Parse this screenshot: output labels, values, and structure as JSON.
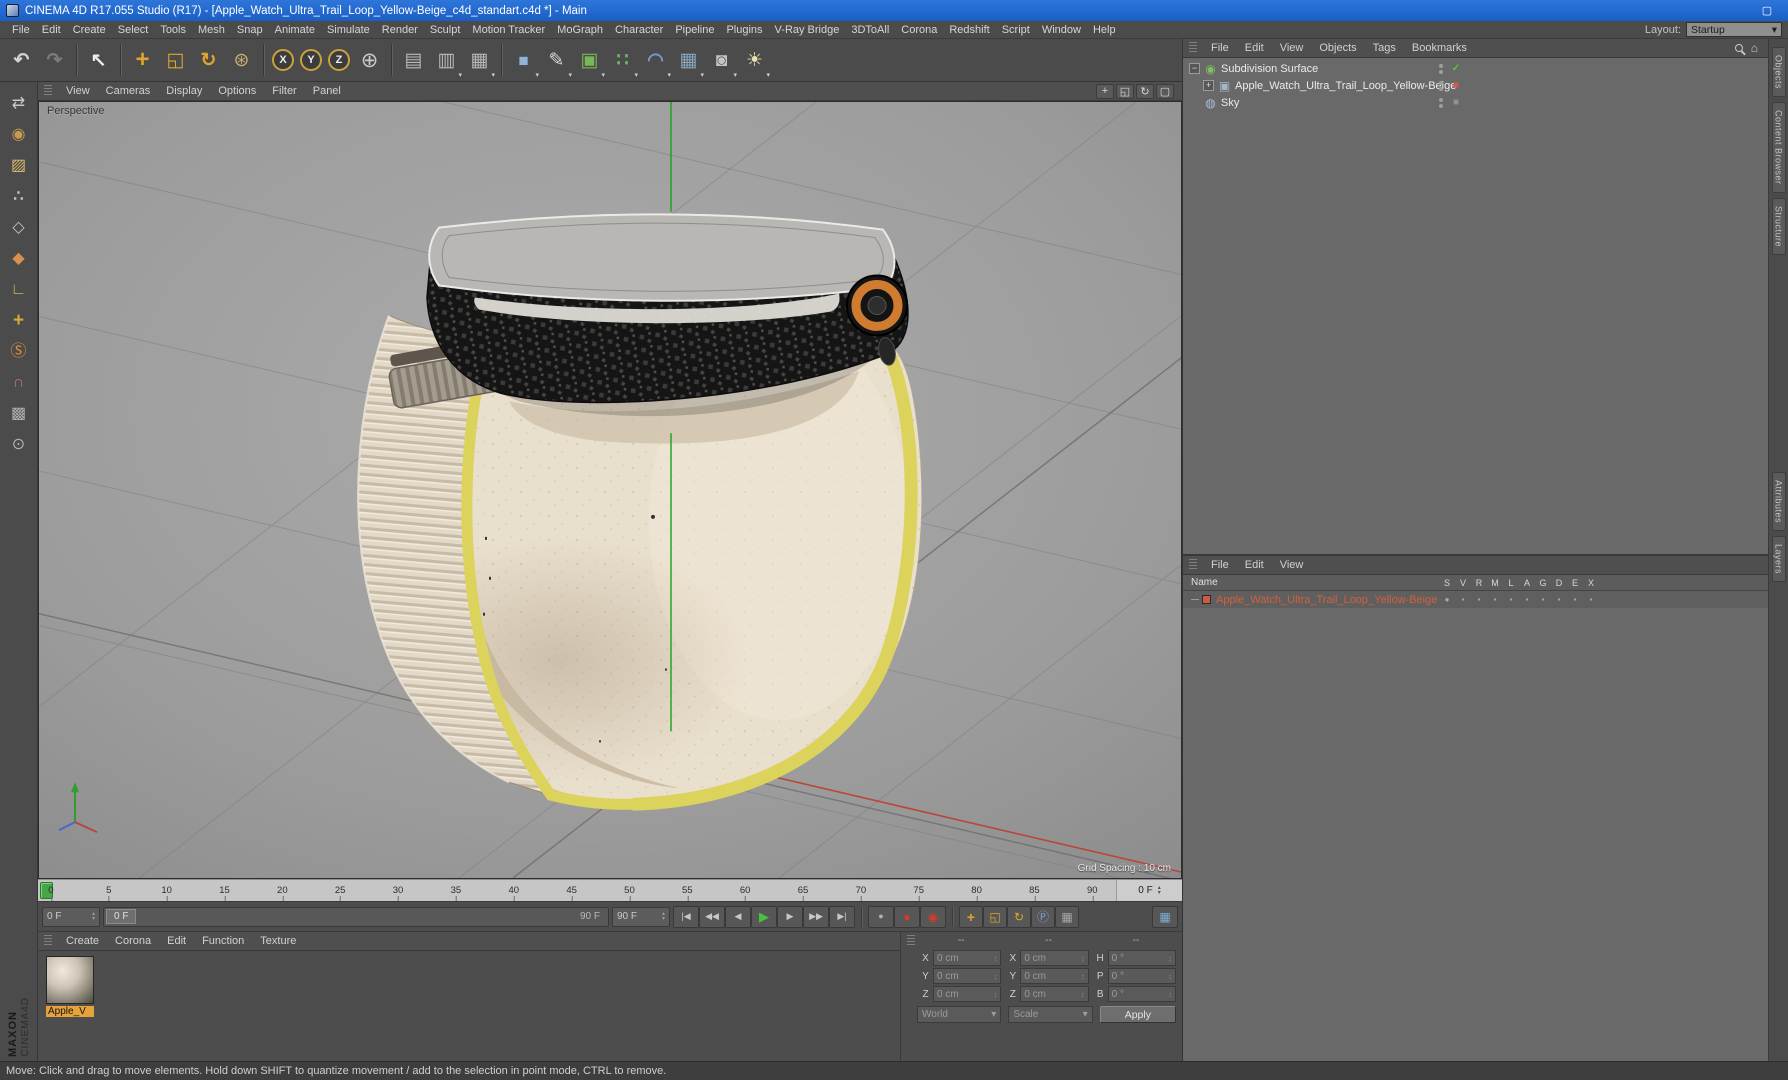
{
  "app": {
    "title": "CINEMA 4D R17.055 Studio (R17) - [Apple_Watch_Ultra_Trail_Loop_Yellow-Beige_c4d_standart.c4d *] - Main",
    "window_buttons": [
      {
        "name": "minimize-button",
        "glyph": "–"
      },
      {
        "name": "maximize-button",
        "glyph": "▢"
      },
      {
        "name": "close-button",
        "glyph": "×"
      }
    ]
  },
  "icons": {
    "chevron_down": "▾",
    "arrow_up": "▴",
    "arrow_down": "▾",
    "home": "⌂"
  },
  "menu_bar": {
    "items": [
      "File",
      "Edit",
      "Create",
      "Select",
      "Tools",
      "Mesh",
      "Snap",
      "Animate",
      "Simulate",
      "Render",
      "Sculpt",
      "Motion Tracker",
      "MoGraph",
      "Character",
      "Pipeline",
      "Plugins",
      "V-Ray Bridge",
      "3DToAll",
      "Corona",
      "Redshift",
      "Script",
      "Window",
      "Help"
    ],
    "layout_label": "Layout:",
    "layout_value": "Startup"
  },
  "toolbar": {
    "history": [
      {
        "name": "undo-icon",
        "glyph": "↶",
        "style": "color:#d2d2d2;font-weight:bold"
      },
      {
        "name": "redo-icon",
        "glyph": "↷",
        "style": "color:#7b7b7b;font-weight:bold"
      }
    ],
    "selection": [
      {
        "name": "live-selection-icon",
        "glyph": "↖",
        "style": "color:#ececec;font-weight:bold"
      }
    ],
    "transform": [
      {
        "name": "move-icon",
        "glyph": "+",
        "style": "color:#dca62e;font-weight:bold;font-size:24px"
      },
      {
        "name": "scale-icon",
        "glyph": "◱",
        "style": "color:#dca62e"
      },
      {
        "name": "rotate-icon",
        "glyph": "↻",
        "style": "color:#dca62e;font-weight:bold"
      },
      {
        "name": "last-tool-icon",
        "glyph": "⊛",
        "style": "color:#c8b070"
      }
    ],
    "axis": [
      {
        "name": "lock-x-axis-button",
        "letter": "X"
      },
      {
        "name": "lock-y-axis-button",
        "letter": "Y"
      },
      {
        "name": "lock-z-axis-button",
        "letter": "Z"
      }
    ],
    "coord_glyph": "⊕",
    "render": [
      {
        "name": "render-view-icon",
        "glyph": "▤",
        "style": "color:#b8b8b8"
      },
      {
        "name": "render-picture-viewer-icon",
        "glyph": "▥",
        "style": "color:#b8b8b8",
        "dd": "▾"
      },
      {
        "name": "render-settings-icon",
        "glyph": "▦",
        "style": "color:#b8b8b8",
        "dd": "▾"
      }
    ],
    "create": [
      {
        "name": "primitive-cube-icon",
        "glyph": "■",
        "style": "color:#8fb4d8;font-size:17px",
        "dd": "▾"
      },
      {
        "name": "spline-pen-icon",
        "glyph": "✎",
        "style": "color:#d8d8d8",
        "dd": "▾"
      },
      {
        "name": "subdivision-generator-icon",
        "glyph": "▣",
        "style": "color:#78b858",
        "dd": "▾"
      },
      {
        "name": "mograph-icon",
        "glyph": "∷",
        "style": "color:#6cb46c;font-weight:bold",
        "dd": "▾"
      },
      {
        "name": "deformer-icon",
        "glyph": "◠",
        "style": "color:#7898d8;font-weight:bold",
        "dd": "▾"
      },
      {
        "name": "environment-icon",
        "glyph": "▦",
        "style": "color:#88a8c0",
        "dd": "▾"
      },
      {
        "name": "camera-icon",
        "glyph": "◙",
        "style": "color:#c4c4c4",
        "dd": "▾"
      },
      {
        "name": "light-icon",
        "glyph": "☀",
        "style": "color:#e8e0b0",
        "dd": "▾"
      }
    ]
  },
  "left_toolbar": {
    "items": [
      {
        "name": "make-editable-icon",
        "glyph": "⇄",
        "style": "color:#c8c8c8"
      },
      {
        "name": "model-mode-icon",
        "glyph": "◉",
        "style": "color:#c89a50"
      },
      {
        "name": "texture-mode-icon",
        "glyph": "▨",
        "style": "color:#d8b868"
      },
      {
        "name": "points-mode-icon",
        "glyph": "∴",
        "style": "color:#c4c4c4;font-weight:bold"
      },
      {
        "name": "edges-mode-icon",
        "glyph": "◇",
        "style": "color:#c4c4c4"
      },
      {
        "name": "polygons-mode-icon",
        "glyph": "◆",
        "style": "color:#d89050"
      },
      {
        "name": "workplane-mode-icon",
        "glyph": "∟",
        "style": "color:#d0b060;font-weight:bold"
      },
      {
        "name": "axis-modification-icon",
        "glyph": "+",
        "style": "color:#d8a838;font-weight:bold;font-size:19px"
      },
      {
        "name": "solo-mode-icon",
        "glyph": "Ⓢ",
        "style": "color:#e09040"
      },
      {
        "name": "snap-icon",
        "glyph": "∩",
        "style": "color:#c87070;font-weight:bold"
      },
      {
        "name": "lock-workplane-icon",
        "glyph": "▩",
        "style": "color:#b0b0b0"
      },
      {
        "name": "workplane-icon",
        "glyph": "⊙",
        "style": "color:#b0b0b0"
      }
    ]
  },
  "viewport": {
    "menus": [
      "View",
      "Cameras",
      "Display",
      "Options",
      "Filter",
      "Panel"
    ],
    "label": "Perspective",
    "grid_spacing": "Grid Spacing : 10 cm",
    "nav_icons": [
      {
        "name": "pan-view-icon",
        "glyph": "+"
      },
      {
        "name": "zoom-view-icon",
        "glyph": "◱"
      },
      {
        "name": "rotate-view-icon",
        "glyph": "↻"
      },
      {
        "name": "toggle-view-icon",
        "glyph": "▢"
      }
    ]
  },
  "object_manager": {
    "menus": [
      "File",
      "Edit",
      "View",
      "Objects",
      "Tags",
      "Bookmarks"
    ],
    "rows": [
      {
        "label": "Subdivision Surface",
        "expander": "−",
        "icon_glyph": "◉",
        "icon_style": "color:#7fbf5f",
        "row_style": "padding-left:6px",
        "status_glyph": "✓",
        "status_style": "color:#58c040;font-weight:bold"
      },
      {
        "label": "Apple_Watch_Ultra_Trail_Loop_Yellow-Beige",
        "expander": "+",
        "icon_glyph": "▣",
        "icon_style": "color:#9fb8cc",
        "row_style": "padding-left:20px",
        "status_glyph": "■",
        "status_style": "color:#cc5f43"
      },
      {
        "label": "Sky",
        "expander": "",
        "exp_style": "visibility:hidden",
        "icon_glyph": "◍",
        "icon_style": "color:#a8c0d8",
        "row_style": "padding-left:6px",
        "status_glyph": "■",
        "status_style": "color:#909090"
      }
    ]
  },
  "layer_manager": {
    "menus": [
      "File",
      "Edit",
      "View"
    ],
    "name_header": "Name",
    "columns": [
      "S",
      "V",
      "R",
      "M",
      "L",
      "A",
      "G",
      "D",
      "E",
      "X"
    ],
    "rows": [
      {
        "label": "Apple_Watch_Ultra_Trail_Loop_Yellow-Beige",
        "swatch_style": "background:#cc5a44",
        "cells": [
          "●",
          "▪",
          "▪",
          "▪",
          "▪",
          "▪",
          "▪",
          "▪",
          "▪",
          "▪"
        ]
      }
    ]
  },
  "side_tabs": {
    "upper": [
      "Objects",
      "Content Browser",
      "Structure"
    ],
    "lower": [
      "Attributes",
      "Layers"
    ]
  },
  "timeline": {
    "ticks": [
      "0",
      "5",
      "10",
      "15",
      "20",
      "25",
      "30",
      "35",
      "40",
      "45",
      "50",
      "55",
      "60",
      "65",
      "70",
      "75",
      "80",
      "85",
      "90"
    ],
    "current": "0 F"
  },
  "transport": {
    "fields": {
      "start": "0 F",
      "slider_start": "0 F",
      "slider_end": "90 F",
      "end": "90 F"
    },
    "buttons": [
      {
        "name": "goto-start-button",
        "glyph": "|◀"
      },
      {
        "name": "previous-key-button",
        "glyph": "◀◀"
      },
      {
        "name": "previous-frame-button",
        "glyph": "◀"
      },
      {
        "name": "play-button",
        "glyph": "▶",
        "style": "color:#46c242;font-size:13px"
      },
      {
        "name": "next-frame-button",
        "glyph": "▶"
      },
      {
        "name": "next-key-button",
        "glyph": "▶▶"
      },
      {
        "name": "goto-end-button",
        "glyph": "▶|"
      }
    ],
    "record": [
      {
        "name": "record-keyframe-button",
        "glyph": "●",
        "style": "color:#b0b0b0"
      },
      {
        "name": "autokeying-button",
        "glyph": "●",
        "style": "color:#d23c28;font-size:12px"
      },
      {
        "name": "record-options-button",
        "glyph": "◉",
        "style": "color:#d23c28;font-size:12px"
      }
    ],
    "toggles": [
      {
        "name": "record-position-toggle",
        "glyph": "+",
        "style": "color:#dca62e;font-weight:bold;font-size:14px"
      },
      {
        "name": "record-scale-toggle",
        "glyph": "◱",
        "style": "color:#dca62e;font-size:12px"
      },
      {
        "name": "record-rotation-toggle",
        "glyph": "↻",
        "style": "color:#dca62e;font-size:12px"
      },
      {
        "name": "record-parameter-toggle",
        "glyph": "Ⓟ",
        "style": "color:#78a0d8;font-size:12px"
      },
      {
        "name": "record-pla-toggle",
        "glyph": "▦",
        "style": "color:#a8a8a8;font-size:12px"
      }
    ],
    "presets_glyph": "▦"
  },
  "materials_palette": {
    "menus": [
      "Create",
      "Corona",
      "Edit",
      "Function",
      "Texture"
    ],
    "materials": [
      {
        "label": "Apple_V"
      }
    ]
  },
  "coordinates": {
    "groups": [
      {
        "header": "--",
        "rows": [
          {
            "label": "X",
            "value": "0 cm"
          },
          {
            "label": "Y",
            "value": "0 cm"
          },
          {
            "label": "Z",
            "value": "0 cm"
          }
        ]
      },
      {
        "header": "--",
        "rows": [
          {
            "label": "X",
            "value": "0 cm"
          },
          {
            "label": "Y",
            "value": "0 cm"
          },
          {
            "label": "Z",
            "value": "0 cm"
          }
        ]
      },
      {
        "header": "--",
        "rows": [
          {
            "label": "H",
            "value": "0 °"
          },
          {
            "label": "P",
            "value": "0 °"
          },
          {
            "label": "B",
            "value": "0 °"
          }
        ]
      }
    ],
    "mode_dropdown": "World",
    "size_dropdown": "Scale",
    "apply_label": "Apply"
  },
  "status_bar": {
    "text": "Move: Click and drag to move elements. Hold down SHIFT to quantize movement / add to the selection in point mode, CTRL to remove."
  },
  "brand": {
    "line1": "MAXON",
    "line2": "CINEMA4D"
  },
  "colors": {
    "titlebar_blue": "#1a5ec6",
    "panel_gray": "#4d4d4d",
    "content_gray": "#696969",
    "viewport_gray": "#9e9e9e",
    "accent_orange": "#cf7c30",
    "band_cream": "#e9dfcd",
    "band_yellow": "#dcd35c",
    "layer_red": "#cc5a44",
    "select_green": "#46a546",
    "material_label_orange": "#e6a33a"
  }
}
